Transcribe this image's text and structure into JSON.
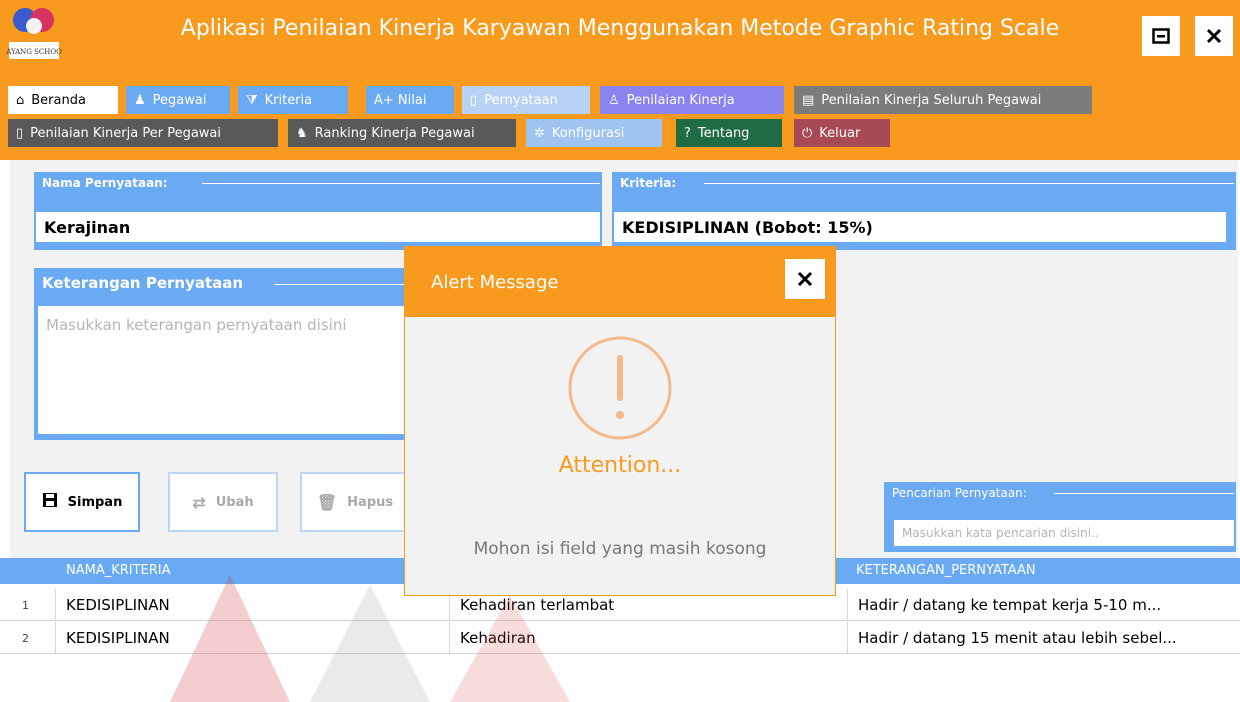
{
  "window": {
    "title": "Aplikasi Penilaian Kinerja Karyawan Menggunakan Metode Graphic Rating Scale",
    "logo_text": "SAYANG SCHOOL"
  },
  "menu": {
    "row1": [
      {
        "label": "Beranda",
        "icon": "home-icon"
      },
      {
        "label": "Pegawai",
        "icon": "users-icon"
      },
      {
        "label": "Kriteria",
        "icon": "filter-sort-icon"
      },
      {
        "label": "A+ Nilai",
        "icon": "grade-icon"
      },
      {
        "label": "Pernyataan",
        "icon": "document-icon"
      },
      {
        "label": "Penilaian Kinerja",
        "icon": "person-icon"
      },
      {
        "label": "Penilaian Kinerja Seluruh Pegawai",
        "icon": "report-icon"
      }
    ],
    "row2": [
      {
        "label": "Penilaian Kinerja Per Pegawai",
        "icon": "document-icon"
      },
      {
        "label": "Ranking Kinerja Pegawai",
        "icon": "thumbs-up-icon"
      },
      {
        "label": "Konfigurasi",
        "icon": "gear-icon"
      },
      {
        "label": "Tentang",
        "icon": "question-icon"
      },
      {
        "label": "Keluar",
        "icon": "power-icon"
      }
    ]
  },
  "form": {
    "nama_label": "Nama Pernyataan:",
    "nama_value": "Kerajinan",
    "kriteria_label": "Kriteria:",
    "kriteria_value": "KEDISIPLINAN (Bobot: 15%)",
    "keterangan_label": "Keterangan Pernyataan",
    "keterangan_placeholder": "Masukkan keterangan pernyataan disini",
    "search_label": "Pencarian Pernyataan:",
    "search_placeholder": "Masukkan kata pencarian disini.."
  },
  "actions": {
    "simpan": "Simpan",
    "ubah": "Ubah",
    "hapus": "Hapus"
  },
  "table": {
    "columns": [
      "NAMA_KRITERIA",
      "",
      "KETERANGAN_PERNYATAAN"
    ],
    "rows": [
      {
        "num": "1",
        "kriteria": "KEDISIPLINAN",
        "pernyataan": "Kehadiran terlambat",
        "keterangan": "Hadir / datang ke tempat kerja 5-10 m..."
      },
      {
        "num": "2",
        "kriteria": "KEDISIPLINAN",
        "pernyataan": "Kehadiran",
        "keterangan": "Hadir / datang 15 menit atau lebih sebel..."
      }
    ]
  },
  "alert": {
    "title": "Alert Message",
    "heading": "Attention...",
    "message": "Mohon isi field yang masih kosong"
  },
  "colors": {
    "accent": "#f79a1e",
    "primary": "#6aaaf3"
  }
}
